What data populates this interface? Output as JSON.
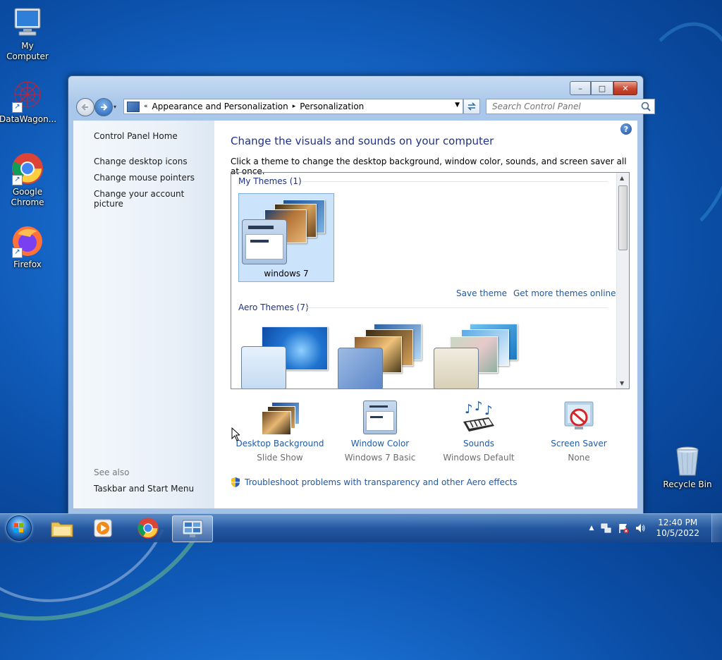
{
  "desktop": {
    "icons": [
      {
        "label": "My Computer"
      },
      {
        "label": "DataWagon..."
      },
      {
        "label": "Google Chrome"
      },
      {
        "label": "Firefox"
      },
      {
        "label": "Recycle Bin"
      }
    ]
  },
  "window": {
    "controls": {
      "minimize": "–",
      "maximize": "□",
      "close": "✕"
    },
    "address": {
      "overflow": "«",
      "segments": [
        "Appearance and Personalization",
        "Personalization"
      ],
      "separator": "▸"
    },
    "search": {
      "placeholder": "Search Control Panel"
    },
    "help": "?",
    "sidebar": {
      "home": "Control Panel Home",
      "links": [
        "Change desktop icons",
        "Change mouse pointers",
        "Change your account picture"
      ],
      "see_also": "See also",
      "see_also_links": [
        "Taskbar and Start Menu"
      ]
    },
    "main": {
      "title": "Change the visuals and sounds on your computer",
      "subtitle": "Click a theme to change the desktop background, window color, sounds, and screen saver all at once.",
      "my_themes_header": "My Themes (1)",
      "selected_theme": "windows 7",
      "save_theme": "Save theme",
      "get_more": "Get more themes online",
      "aero_header": "Aero Themes (7)"
    },
    "bottom": [
      {
        "label": "Desktop Background",
        "value": "Slide Show"
      },
      {
        "label": "Window Color",
        "value": "Windows 7 Basic"
      },
      {
        "label": "Sounds",
        "value": "Windows Default"
      },
      {
        "label": "Screen Saver",
        "value": "None"
      }
    ],
    "troubleshoot": "Troubleshoot problems with transparency and other Aero effects"
  },
  "taskbar": {
    "clock": {
      "time": "12:40 PM",
      "date": "10/5/2022"
    }
  }
}
